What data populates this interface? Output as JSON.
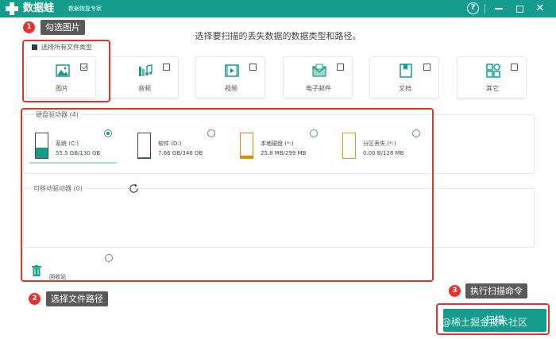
{
  "titlebar": {
    "app_name": "数据蛙",
    "subtitle": "数据恢复专家",
    "help_glyph": "?",
    "close_glyph": "✕"
  },
  "instruction": "选择要扫描的丢失数据的数据类型和路径。",
  "callouts": [
    {
      "number": "1",
      "text": "勾选图片"
    },
    {
      "number": "2",
      "text": "选择文件路径"
    },
    {
      "number": "3",
      "text": "执行扫描命令"
    }
  ],
  "file_types": {
    "select_all_label": "选择所有文件类型",
    "items": [
      {
        "label": "图片",
        "icon": "image-icon",
        "checked": true
      },
      {
        "label": "音频",
        "icon": "music-icon",
        "checked": false
      },
      {
        "label": "视频",
        "icon": "video-icon",
        "checked": false
      },
      {
        "label": "电子邮件",
        "icon": "mail-icon",
        "checked": false
      },
      {
        "label": "文档",
        "icon": "document-icon",
        "checked": false
      },
      {
        "label": "其它",
        "icon": "others-icon",
        "checked": false
      }
    ]
  },
  "hard_drives": {
    "title": "硬盘驱动器 (4)",
    "drives": [
      {
        "name": "系统 (C:)",
        "size": "55.5 GB/130 GB",
        "selected": true,
        "fill": 0.43,
        "color": "#159c8d"
      },
      {
        "name": "软件 (D:)",
        "size": "7.66 GB/346 GB",
        "selected": false,
        "fill": 0.02,
        "color": "#159c8d"
      },
      {
        "name": "本地磁盘 (*:)",
        "size": "25.8 MB/299 MB",
        "selected": false,
        "fill": 0.09,
        "color": "#e08a00"
      },
      {
        "name": "分区丢失 (*:)",
        "size": "0.00  B/128 MB",
        "selected": false,
        "fill": 0.0,
        "color": "#e0a000"
      }
    ]
  },
  "removable": {
    "title": "可移动驱动器 (0)",
    "refresh_icon": "refresh-icon"
  },
  "recycle_bin": {
    "label": "回收站",
    "icon": "trash-icon"
  },
  "scan_button": "扫描",
  "watermark": "@稀土掘金技术社区"
}
